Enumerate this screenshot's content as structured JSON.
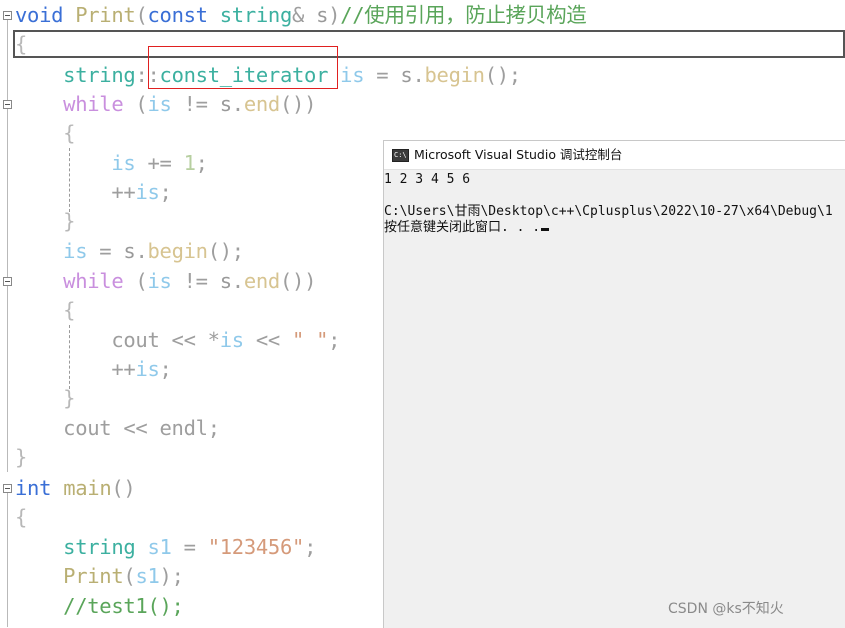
{
  "code_lines": [
    {
      "tokens": [
        {
          "t": "void",
          "c": "#3a6fd6"
        },
        {
          "t": " "
        },
        {
          "t": "Print",
          "c": "#b9af73"
        },
        {
          "t": "(",
          "c": "#9e9e9e"
        },
        {
          "t": "const",
          "c": "#3a6fd6"
        },
        {
          "t": " "
        },
        {
          "t": "string",
          "c": "#3cb0a0"
        },
        {
          "t": "&",
          "c": "#9e9e9e"
        },
        {
          "t": " "
        },
        {
          "t": "s",
          "c": "#999999"
        },
        {
          "t": ")",
          "c": "#9e9e9e"
        },
        {
          "t": "//使用引用，防止拷贝构造",
          "c": "#5aa55a"
        }
      ]
    },
    {
      "tokens": [
        {
          "t": "{",
          "c": "#b8b8b8"
        }
      ]
    },
    {
      "tokens": [
        {
          "t": "    "
        },
        {
          "t": "string",
          "c": "#3cb0a0"
        },
        {
          "t": "::",
          "c": "#9e9e9e"
        },
        {
          "t": "const_iterator",
          "c": "#3cb0a0"
        },
        {
          "t": " "
        },
        {
          "t": "is",
          "c": "#8fc9ea"
        },
        {
          "t": " = ",
          "c": "#9e9e9e"
        },
        {
          "t": "s",
          "c": "#999999"
        },
        {
          "t": ".",
          "c": "#9e9e9e"
        },
        {
          "t": "begin",
          "c": "#d7c491"
        },
        {
          "t": "();",
          "c": "#9e9e9e"
        }
      ]
    },
    {
      "tokens": [
        {
          "t": "    "
        },
        {
          "t": "while",
          "c": "#c98fde"
        },
        {
          "t": " (",
          "c": "#9e9e9e"
        },
        {
          "t": "is",
          "c": "#8fc9ea"
        },
        {
          "t": " != ",
          "c": "#9e9e9e"
        },
        {
          "t": "s",
          "c": "#999999"
        },
        {
          "t": ".",
          "c": "#9e9e9e"
        },
        {
          "t": "end",
          "c": "#d7c491"
        },
        {
          "t": "())",
          "c": "#9e9e9e"
        }
      ]
    },
    {
      "tokens": [
        {
          "t": "    "
        },
        {
          "t": "{",
          "c": "#b8b8b8"
        }
      ]
    },
    {
      "tokens": [
        {
          "t": "        "
        },
        {
          "t": "is",
          "c": "#8fc9ea"
        },
        {
          "t": " += ",
          "c": "#9e9e9e"
        },
        {
          "t": "1",
          "c": "#b7cfa0"
        },
        {
          "t": ";",
          "c": "#9e9e9e"
        }
      ]
    },
    {
      "tokens": [
        {
          "t": "        "
        },
        {
          "t": "++",
          "c": "#9e9e9e"
        },
        {
          "t": "is",
          "c": "#8fc9ea"
        },
        {
          "t": ";",
          "c": "#9e9e9e"
        }
      ]
    },
    {
      "tokens": [
        {
          "t": "    "
        },
        {
          "t": "}",
          "c": "#b8b8b8"
        }
      ]
    },
    {
      "tokens": [
        {
          "t": "    "
        },
        {
          "t": "is",
          "c": "#8fc9ea"
        },
        {
          "t": " = ",
          "c": "#9e9e9e"
        },
        {
          "t": "s",
          "c": "#999999"
        },
        {
          "t": ".",
          "c": "#9e9e9e"
        },
        {
          "t": "begin",
          "c": "#d7c491"
        },
        {
          "t": "();",
          "c": "#9e9e9e"
        }
      ]
    },
    {
      "tokens": [
        {
          "t": "    "
        },
        {
          "t": "while",
          "c": "#c98fde"
        },
        {
          "t": " (",
          "c": "#9e9e9e"
        },
        {
          "t": "is",
          "c": "#8fc9ea"
        },
        {
          "t": " != ",
          "c": "#9e9e9e"
        },
        {
          "t": "s",
          "c": "#999999"
        },
        {
          "t": ".",
          "c": "#9e9e9e"
        },
        {
          "t": "end",
          "c": "#d7c491"
        },
        {
          "t": "())",
          "c": "#9e9e9e"
        }
      ]
    },
    {
      "tokens": [
        {
          "t": "    "
        },
        {
          "t": "{",
          "c": "#b8b8b8"
        }
      ]
    },
    {
      "tokens": [
        {
          "t": "        "
        },
        {
          "t": "cout",
          "c": "#9e9e9e"
        },
        {
          "t": " << *",
          "c": "#9e9e9e"
        },
        {
          "t": "is",
          "c": "#8fc9ea"
        },
        {
          "t": " << ",
          "c": "#9e9e9e"
        },
        {
          "t": "\" \"",
          "c": "#d59a7a"
        },
        {
          "t": ";",
          "c": "#9e9e9e"
        }
      ]
    },
    {
      "tokens": [
        {
          "t": "        "
        },
        {
          "t": "++",
          "c": "#9e9e9e"
        },
        {
          "t": "is",
          "c": "#8fc9ea"
        },
        {
          "t": ";",
          "c": "#9e9e9e"
        }
      ]
    },
    {
      "tokens": [
        {
          "t": "    "
        },
        {
          "t": "}",
          "c": "#b8b8b8"
        }
      ]
    },
    {
      "tokens": [
        {
          "t": "    "
        },
        {
          "t": "cout",
          "c": "#9e9e9e"
        },
        {
          "t": " << ",
          "c": "#9e9e9e"
        },
        {
          "t": "endl",
          "c": "#9e9e9e"
        },
        {
          "t": ";",
          "c": "#9e9e9e"
        }
      ]
    },
    {
      "tokens": [
        {
          "t": "}",
          "c": "#b8b8b8"
        }
      ]
    },
    {
      "tokens": [
        {
          "t": "int",
          "c": "#3a6fd6"
        },
        {
          "t": " "
        },
        {
          "t": "main",
          "c": "#b9af73"
        },
        {
          "t": "()",
          "c": "#9e9e9e"
        }
      ]
    },
    {
      "tokens": [
        {
          "t": "{",
          "c": "#b8b8b8"
        }
      ]
    },
    {
      "tokens": [
        {
          "t": "    "
        },
        {
          "t": "string",
          "c": "#3cb0a0"
        },
        {
          "t": " "
        },
        {
          "t": "s1",
          "c": "#8fc9ea"
        },
        {
          "t": " = ",
          "c": "#9e9e9e"
        },
        {
          "t": "\"123456\"",
          "c": "#d59a7a"
        },
        {
          "t": ";",
          "c": "#9e9e9e"
        }
      ]
    },
    {
      "tokens": [
        {
          "t": "    "
        },
        {
          "t": "Print",
          "c": "#b9af73"
        },
        {
          "t": "(",
          "c": "#9e9e9e"
        },
        {
          "t": "s1",
          "c": "#8fc9ea"
        },
        {
          "t": ");",
          "c": "#9e9e9e"
        }
      ]
    },
    {
      "tokens": [
        {
          "t": "    "
        },
        {
          "t": "//test1();",
          "c": "#5aa55a"
        }
      ]
    }
  ],
  "console": {
    "title": "Microsoft Visual Studio 调试控制台",
    "icon": "console-window-icon",
    "icon_glyph": "C:\\",
    "lines": [
      "1 2 3 4 5 6",
      "",
      "C:\\Users\\甘雨\\Desktop\\c++\\Cplusplus\\2022\\10-27\\x64\\Debug\\1",
      "按任意键关闭此窗口. . ."
    ]
  },
  "watermark": "CSDN @ks不知火",
  "colors": {
    "keyword": "#3a6fd6",
    "type": "#3cb0a0",
    "comment": "#5aa55a",
    "string": "#d59a7a",
    "highlight": "#e02020"
  }
}
